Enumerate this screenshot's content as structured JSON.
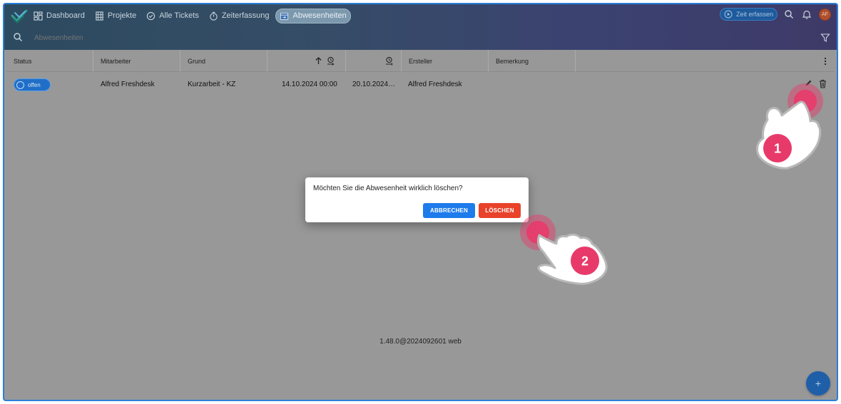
{
  "header": {
    "nav": [
      {
        "label": "Dashboard",
        "icon": "dashboard-icon"
      },
      {
        "label": "Projekte",
        "icon": "grid-icon"
      },
      {
        "label": "Alle Tickets",
        "icon": "check-circle-icon"
      },
      {
        "label": "Zeiterfassung",
        "icon": "timer-icon"
      },
      {
        "label": "Abwesenheiten",
        "icon": "calendar-icon",
        "active": true
      }
    ],
    "time_button_label": "Zeit erfassen",
    "avatar_initials": "AF"
  },
  "search": {
    "placeholder": "Abwesenheiten"
  },
  "table": {
    "columns": [
      "Status",
      "Mitarbeiter",
      "Grund",
      "",
      "",
      "Ersteller",
      "Bemerkung"
    ],
    "rows": [
      {
        "status": "offen",
        "mitarbeiter": "Alfred Freshdesk",
        "grund": "Kurzarbeit - KZ",
        "von": "14.10.2024 00:00",
        "bis": "20.10.2024…",
        "ersteller": "Alfred Freshdesk",
        "bemerkung": ""
      }
    ]
  },
  "version": "1.48.0@2024092601 web",
  "dialog": {
    "message": "Möchten Sie die Abwesenheit wirklich löschen?",
    "cancel_label": "ABBRECHEN",
    "delete_label": "LÖSCHEN"
  },
  "annotations": [
    {
      "number": "1",
      "target": "delete-row-button"
    },
    {
      "number": "2",
      "target": "dialog-delete-button"
    }
  ],
  "colors": {
    "accent": "#1e7bec",
    "danger": "#e8422a",
    "annotation": "#e83a6a",
    "status_chip": "#1f6fc8"
  }
}
